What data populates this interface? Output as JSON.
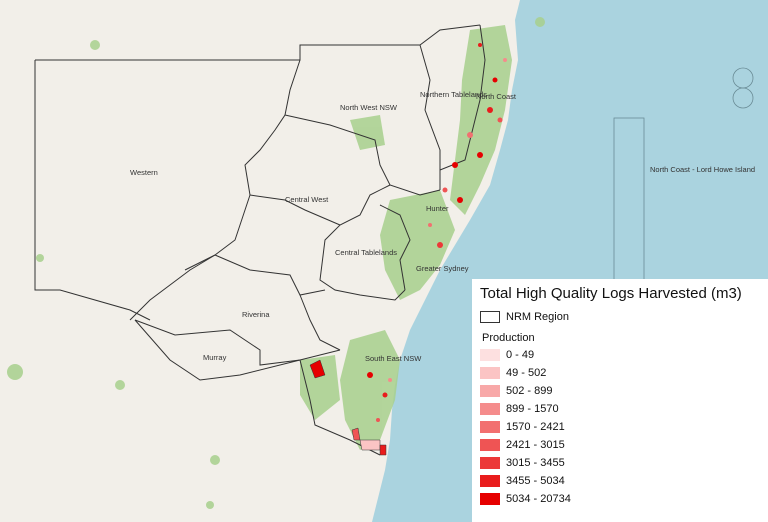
{
  "map": {
    "land_color": "#f2efe9",
    "sea_color": "#aad3df",
    "vegetation_color": "#a8d08d",
    "boundary_color": "#333333",
    "region_labels": [
      "North West NSW",
      "Northern Tablelands",
      "North Coast",
      "Western",
      "Central West",
      "Hunter",
      "Central Tablelands",
      "Greater Sydney",
      "Riverina",
      "Murray",
      "South East NSW",
      "North Coast - Lord Howe Island"
    ]
  },
  "legend": {
    "title": "Total High Quality Logs Harvested (m3)",
    "nrm_label": "NRM Region",
    "production_label": "Production",
    "classes": [
      {
        "label": "0 - 49",
        "color": "#fde0e0"
      },
      {
        "label": "49 - 502",
        "color": "#fbc4c4"
      },
      {
        "label": "502 - 899",
        "color": "#f8a8a8"
      },
      {
        "label": "899 - 1570",
        "color": "#f58c8c"
      },
      {
        "label": "1570 - 2421",
        "color": "#f27070"
      },
      {
        "label": "2421 - 3015",
        "color": "#ef5454"
      },
      {
        "label": "3015 - 3455",
        "color": "#ec3838"
      },
      {
        "label": "3455 - 5034",
        "color": "#e91c1c"
      },
      {
        "label": "5034 - 20734",
        "color": "#e60000"
      }
    ]
  }
}
